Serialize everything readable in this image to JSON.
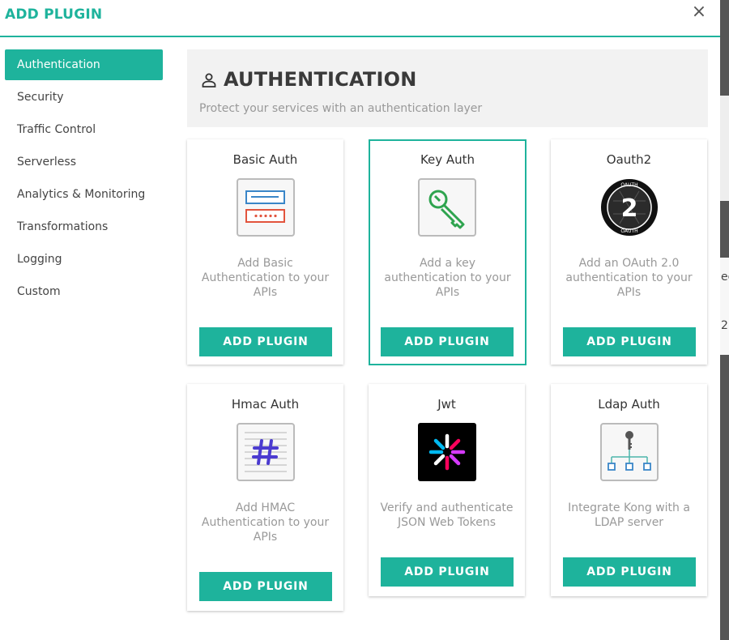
{
  "modal": {
    "title": "ADD PLUGIN",
    "close_label": "×"
  },
  "sidebar": {
    "items": [
      {
        "label": "Authentication",
        "active": true
      },
      {
        "label": "Security"
      },
      {
        "label": "Traffic Control"
      },
      {
        "label": "Serverless"
      },
      {
        "label": "Analytics & Monitoring"
      },
      {
        "label": "Transformations"
      },
      {
        "label": "Logging"
      },
      {
        "label": "Custom"
      }
    ]
  },
  "section": {
    "icon": "user-icon",
    "title": "AUTHENTICATION",
    "description": "Protect your services with an authentication layer"
  },
  "plugins": [
    {
      "name": "Basic Auth",
      "icon": "basic-auth-icon",
      "description": "Add Basic Authentication to your APIs",
      "button": "ADD PLUGIN"
    },
    {
      "name": "Key Auth",
      "icon": "key-icon",
      "description": "Add a key authentication to your APIs",
      "button": "ADD PLUGIN",
      "selected": true
    },
    {
      "name": "Oauth2",
      "icon": "oauth2-icon",
      "description": "Add an OAuth 2.0 authentication to your APIs",
      "button": "ADD PLUGIN"
    },
    {
      "name": "Hmac Auth",
      "icon": "hmac-hash-icon",
      "description": "Add HMAC Authentication to your APIs",
      "button": "ADD PLUGIN"
    },
    {
      "name": "Jwt",
      "icon": "jwt-icon",
      "description": "Verify and authenticate JSON Web Tokens",
      "button": "ADD PLUGIN"
    },
    {
      "name": "Ldap Auth",
      "icon": "ldap-icon",
      "description": "Integrate Kong with a LDAP server",
      "button": "ADD PLUGIN"
    }
  ],
  "background_page": {
    "fragments": [
      "ec",
      "2"
    ]
  },
  "colors": {
    "accent": "#1eb39c",
    "text_muted": "#999999",
    "section_bg": "#f2f2f2"
  }
}
